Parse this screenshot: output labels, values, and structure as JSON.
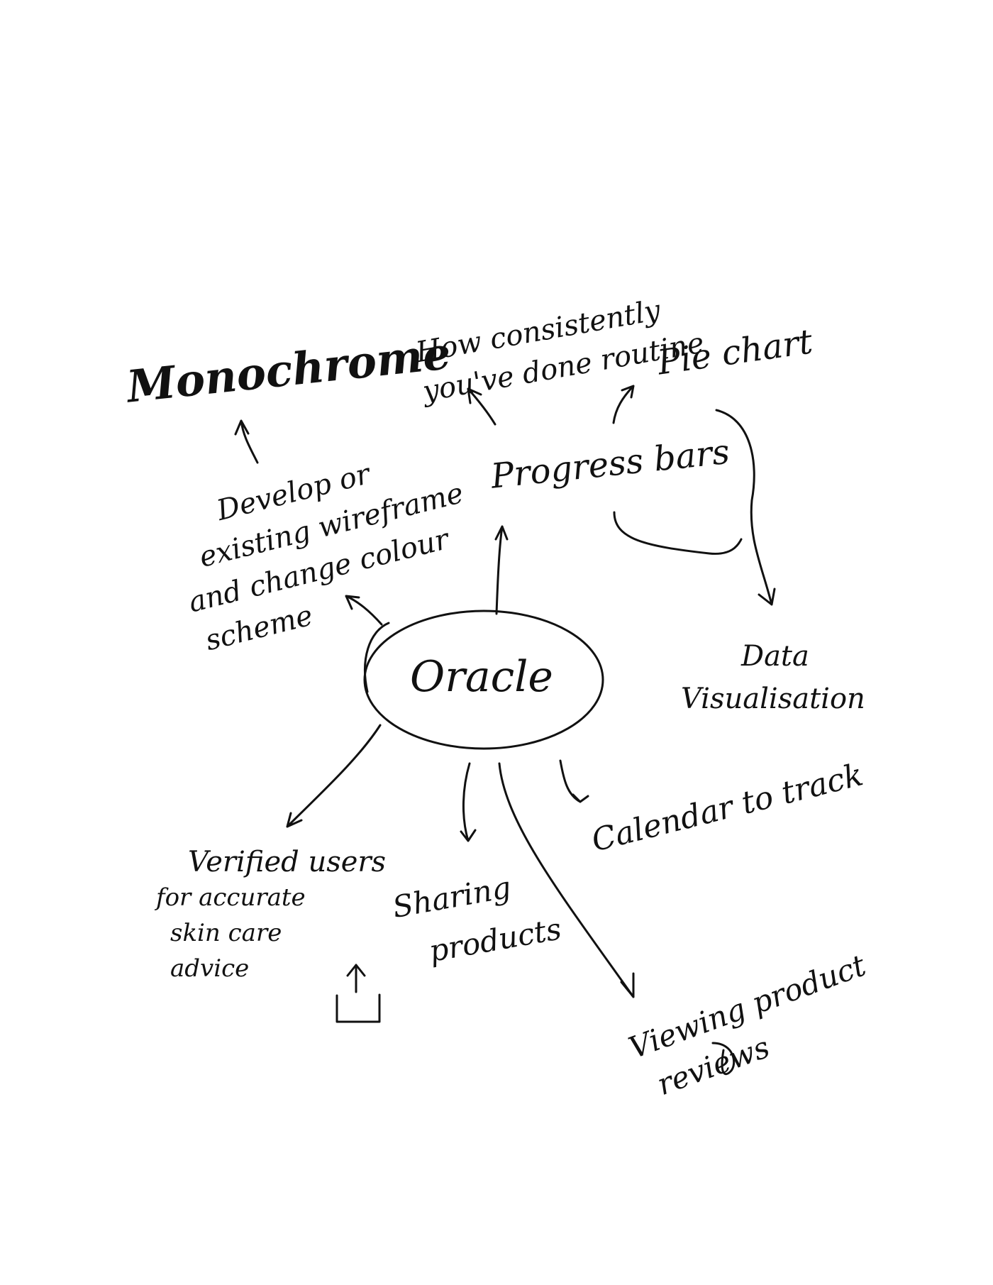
{
  "diagram": {
    "center": {
      "label": "Oracle"
    },
    "nodes": {
      "monochrome": {
        "label": "Monochrome"
      },
      "develop": {
        "lines": [
          "Develop or",
          "existing wireframe",
          "and change colour",
          "scheme"
        ]
      },
      "progress": {
        "label": "Progress bars"
      },
      "consistency": {
        "lines": [
          "How consistently",
          "you've done routine"
        ]
      },
      "pie": {
        "label": "Pie chart"
      },
      "dataviz": {
        "lines": [
          "Data",
          "Visualisation"
        ]
      },
      "calendar": {
        "label": "Calendar to track"
      },
      "verified": {
        "lines": [
          "Verified users",
          "for accurate",
          "skin care",
          "advice"
        ]
      },
      "sharing": {
        "lines": [
          "Sharing",
          "products"
        ]
      },
      "reviews": {
        "lines": [
          "Viewing product",
          "reviews"
        ]
      }
    },
    "icons": {
      "share": "share-upload-icon"
    }
  }
}
